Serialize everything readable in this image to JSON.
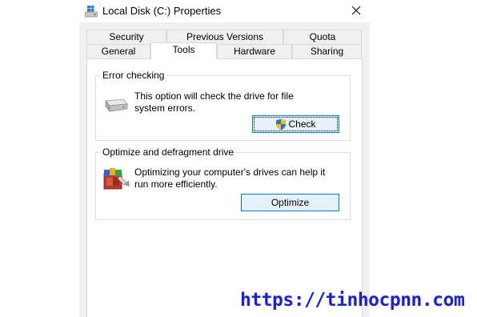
{
  "window": {
    "title": "Local Disk (C:) Properties",
    "close_glyph": "✕"
  },
  "tabs": {
    "row1": [
      "Security",
      "Previous Versions",
      "Quota"
    ],
    "row2": [
      "General",
      "Tools",
      "Hardware",
      "Sharing"
    ],
    "active": "Tools"
  },
  "error_checking": {
    "group_label": "Error checking",
    "description": "This option will check the drive for file system errors.",
    "button_label": "Check",
    "icon": "hard-drive-icon",
    "button_icon": "uac-shield-icon"
  },
  "optimize": {
    "group_label": "Optimize and defragment drive",
    "description": "Optimizing your computer's drives can help it run more efficiently.",
    "button_label": "Optimize",
    "icon": "defragment-icon"
  },
  "watermark": {
    "text": "https://tinhocpnn.com"
  },
  "colors": {
    "accent": "#0078d7",
    "dialog_bg": "#f0f0f0",
    "watermark": "#1a20d8"
  }
}
